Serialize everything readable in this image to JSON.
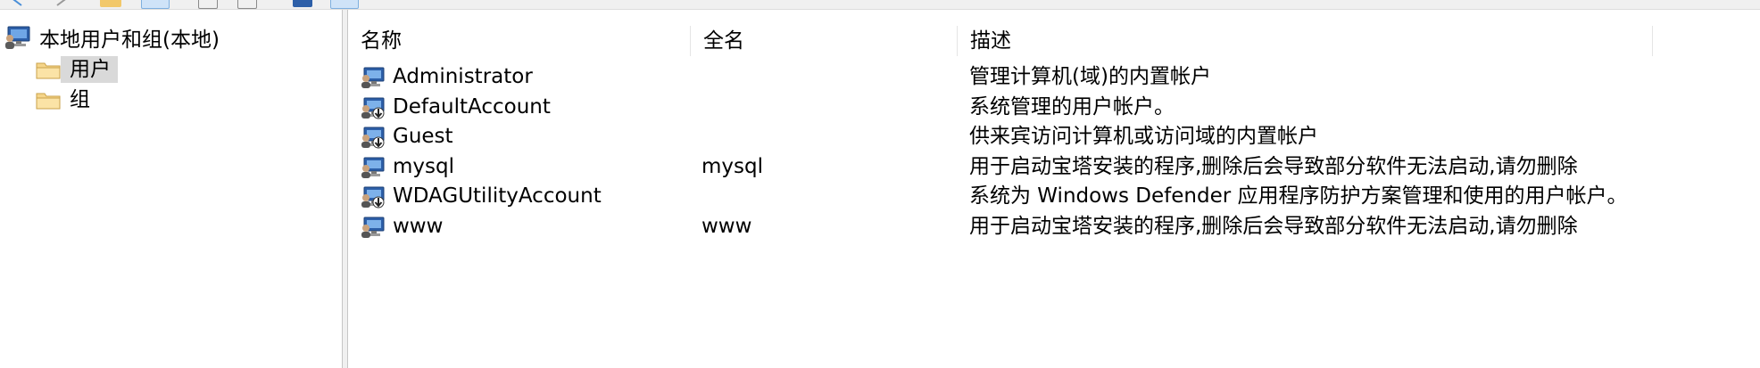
{
  "tree": {
    "root_label": "本地用户和组(本地)",
    "items": [
      {
        "label": "用户",
        "selected": true
      },
      {
        "label": "组",
        "selected": false
      }
    ]
  },
  "list": {
    "columns": [
      "名称",
      "全名",
      "描述"
    ],
    "rows": [
      {
        "name": "Administrator",
        "full_name": "",
        "description": "管理计算机(域)的内置帐户",
        "icon": "user-icon",
        "disabled": false
      },
      {
        "name": "DefaultAccount",
        "full_name": "",
        "description": "系统管理的用户帐户。",
        "icon": "disabled-user-icon",
        "disabled": true
      },
      {
        "name": "Guest",
        "full_name": "",
        "description": "供来宾访问计算机或访问域的内置帐户",
        "icon": "disabled-user-icon",
        "disabled": true
      },
      {
        "name": "mysql",
        "full_name": "mysql",
        "description": "用于启动宝塔安装的程序,删除后会导致部分软件无法启动,请勿删除",
        "icon": "user-icon",
        "disabled": false
      },
      {
        "name": "WDAGUtilityAccount",
        "full_name": "",
        "description": "系统为 Windows Defender 应用程序防护方案管理和使用的用户帐户。",
        "icon": "disabled-user-icon",
        "disabled": true
      },
      {
        "name": "www",
        "full_name": "www",
        "description": "用于启动宝塔安装的程序,删除后会导致部分软件无法启动,请勿删除",
        "icon": "user-icon",
        "disabled": false
      }
    ]
  },
  "colors": {
    "selection": "#d9d9d9",
    "folder": "#f5d58a",
    "monitor": "#2d5fa8"
  }
}
